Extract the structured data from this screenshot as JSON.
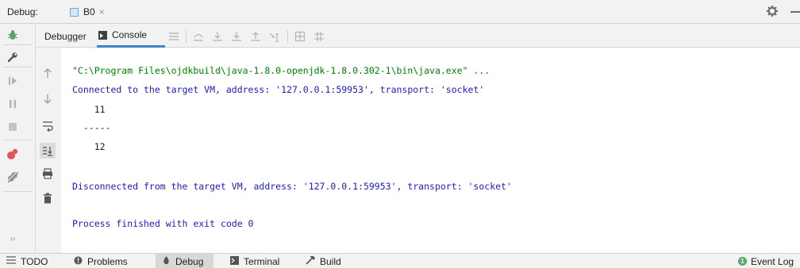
{
  "header": {
    "label": "Debug:",
    "session_tab": "B0",
    "close_glyph": "×"
  },
  "inner_tabs": {
    "debugger_label": "Debugger",
    "console_label": "Console"
  },
  "console": {
    "lines": [
      {
        "text": "\"C:\\Program Files\\ojdkbuild\\java-1.8.0-openjdk-1.8.0.302-1\\bin\\java.exe\" ...",
        "kind": "cmd"
      },
      {
        "text": "Connected to the target VM, address: '127.0.0.1:59953', transport: 'socket'",
        "kind": "info"
      },
      {
        "text": "    11",
        "kind": "out"
      },
      {
        "text": "  -----",
        "kind": "out"
      },
      {
        "text": "    12",
        "kind": "out"
      },
      {
        "text": "",
        "kind": "out"
      },
      {
        "text": "Disconnected from the target VM, address: '127.0.0.1:59953', transport: 'socket'",
        "kind": "info"
      },
      {
        "text": "",
        "kind": "out"
      },
      {
        "text": "Process finished with exit code 0",
        "kind": "info"
      }
    ]
  },
  "bottom_bar": {
    "todo_label": "TODO",
    "problems_label": "Problems",
    "debug_label": "Debug",
    "terminal_label": "Terminal",
    "build_label": "Build",
    "event_log_label": "Event Log",
    "event_count": "1",
    "more_glyph": "››"
  },
  "colors": {
    "accent": "#4083c9",
    "cmd_text": "#008000",
    "info_text": "#1c1cbf",
    "resume_green": "#59a869",
    "stop_red": "#db5860"
  },
  "icons": [
    "bug-icon",
    "wrench-icon",
    "resume-icon",
    "pause-icon",
    "stop-icon",
    "view-breakpoints-icon",
    "mute-breakpoints-icon",
    "gear-icon",
    "up-arrow-icon",
    "down-arrow-icon",
    "soft-wrap-icon",
    "scroll-to-end-icon",
    "print-icon",
    "trash-icon"
  ]
}
